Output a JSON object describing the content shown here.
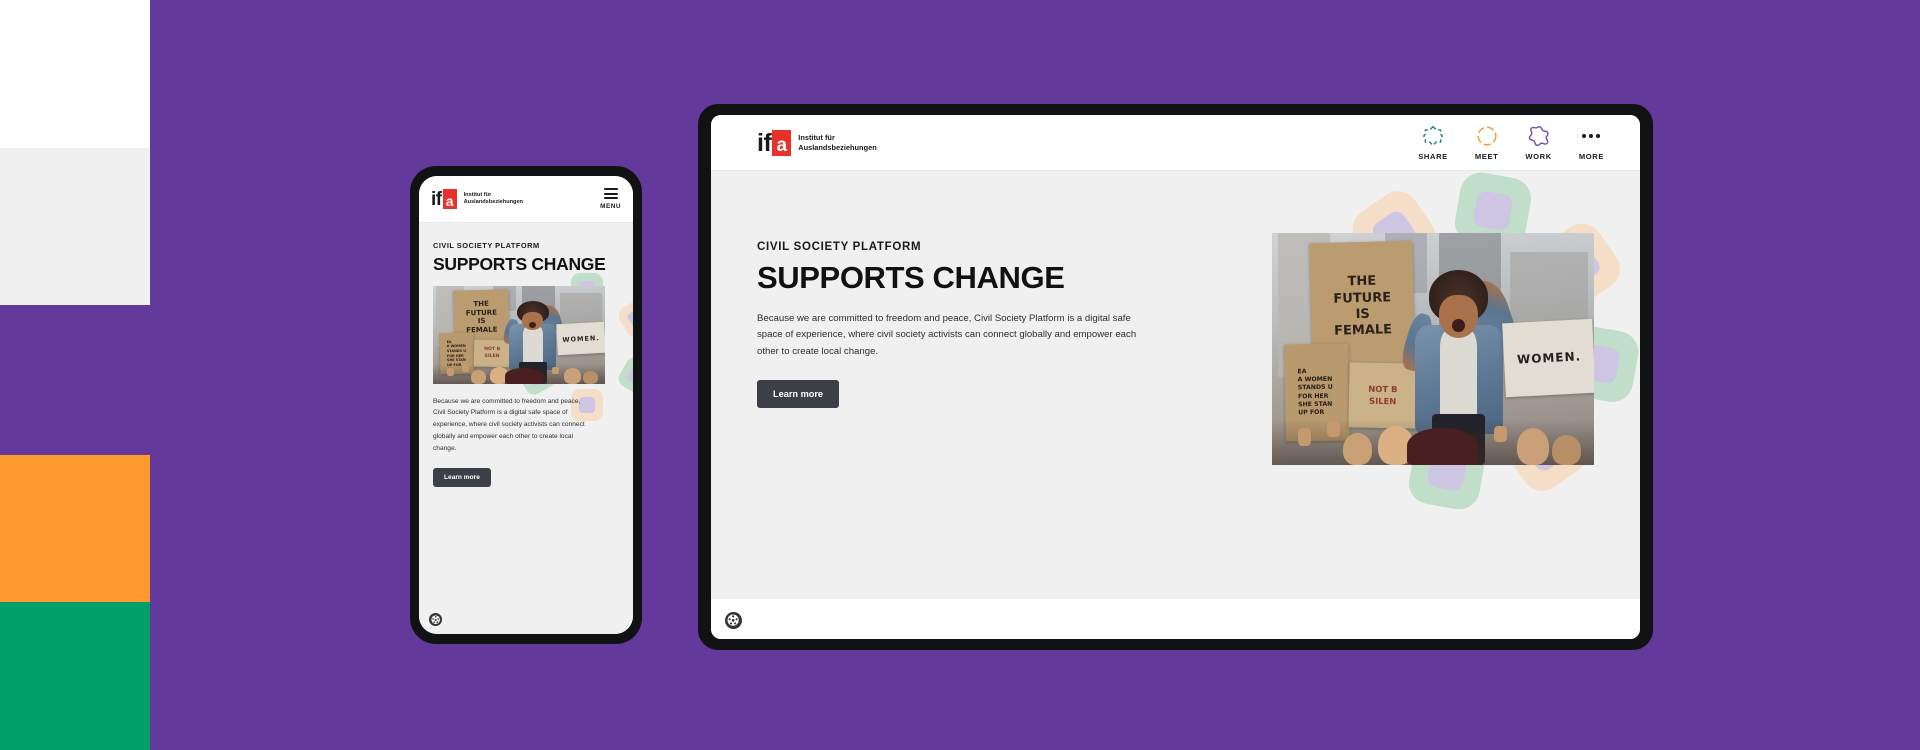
{
  "page": {
    "background_color": "#63399B",
    "accent_red": "#E8312A",
    "button_color": "#3C4046"
  },
  "color_bands": [
    {
      "name": "white-band",
      "color": "#FFFFFF"
    },
    {
      "name": "gray-band",
      "color": "#F0F0F0"
    },
    {
      "name": "purple-band",
      "color": "#63399B"
    },
    {
      "name": "orange-band",
      "color": "#FE9A30"
    },
    {
      "name": "green-band",
      "color": "#00A06A"
    }
  ],
  "logo": {
    "mark_if": "if",
    "mark_a": "a",
    "line1": "Institut für",
    "line2": "Auslandsbeziehungen"
  },
  "tablet": {
    "nav": [
      {
        "label": "SHARE",
        "icon": "share-star-icon",
        "color": "#1E8A5F"
      },
      {
        "label": "MEET",
        "icon": "meet-circle-icon",
        "color": "#F0A03C"
      },
      {
        "label": "WORK",
        "icon": "work-star-icon",
        "color": "#7B4FA8"
      },
      {
        "label": "MORE",
        "icon": "more-dots-icon",
        "color": "#1A1A1A"
      }
    ],
    "hero": {
      "eyebrow": "CIVIL SOCIETY PLATFORM",
      "title": "SUPPORTS CHANGE",
      "paragraph": "Because we are committed to freedom and peace, Civil Society Platform is a digital safe space of experience, where civil society activists can connect globally and empower each other to create local change.",
      "button_label": "Learn more"
    }
  },
  "phone": {
    "menu_label": "MENU",
    "hero": {
      "eyebrow": "CIVIL SOCIETY PLATFORM",
      "title": "SUPPORTS CHANGE",
      "paragraph": "Because we are committed to freedom and peace, Civil Society Platform is a digital safe space of experience, where civil society activists can connect globally and empower each other to create local change.",
      "button_label": "Learn more"
    }
  },
  "photo": {
    "alt": "Women at a protest march holding cardboard signs",
    "signs": {
      "main_line1": "THE",
      "main_line2": "FUTURE",
      "main_line3": "IS",
      "main_line4": "FEMALE",
      "women": "WOMEN.",
      "not_line1": "NOT B",
      "not_line2": "SILEN",
      "each_line1": "EA",
      "each_line2": "A WOMEN",
      "each_line3": "STANDS U",
      "each_line4": "FOR HER",
      "each_line5": "SHE STAN",
      "each_line6": "UP FOR"
    }
  },
  "accessibility": {
    "icon": "accessibility-icon",
    "label": "Accessibility options"
  }
}
